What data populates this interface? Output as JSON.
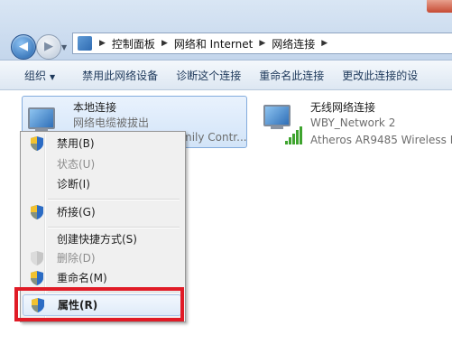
{
  "nav": {
    "back_arrow": "◀",
    "forward_arrow": "▶",
    "history_arrow": "▼",
    "breadcrumb": [
      "控制面板",
      "网络和 Internet",
      "网络连接"
    ],
    "separator": "▶"
  },
  "toolbar": {
    "organize": "组织",
    "organize_drop": "▼",
    "items": [
      "禁用此网络设备",
      "诊断这个连接",
      "重命名此连接",
      "更改此连接的设"
    ]
  },
  "connections": {
    "local": {
      "name": "本地连接",
      "status": "网络电缆被拔出",
      "device_partial": "mily Contr..."
    },
    "wireless": {
      "name": "无线网络连接",
      "network": "WBY_Network  2",
      "device": "Atheros AR9485 Wireless N"
    }
  },
  "context_menu": {
    "items": [
      {
        "label": "禁用(B)",
        "enabled": true,
        "shield": true
      },
      {
        "label": "状态(U)",
        "enabled": false,
        "shield": false
      },
      {
        "label": "诊断(I)",
        "enabled": true,
        "shield": false
      },
      {
        "label": "桥接(G)",
        "enabled": true,
        "shield": true
      },
      {
        "label": "创建快捷方式(S)",
        "enabled": true,
        "shield": false
      },
      {
        "label": "删除(D)",
        "enabled": false,
        "shield": true
      },
      {
        "label": "重命名(M)",
        "enabled": true,
        "shield": true
      },
      {
        "label": "属性(R)",
        "enabled": true,
        "shield": true,
        "highlighted": true
      }
    ]
  },
  "colors": {
    "highlight_box": "#e01b26",
    "shield_blue": "#2c6cc4",
    "shield_yellow": "#f2c230"
  }
}
